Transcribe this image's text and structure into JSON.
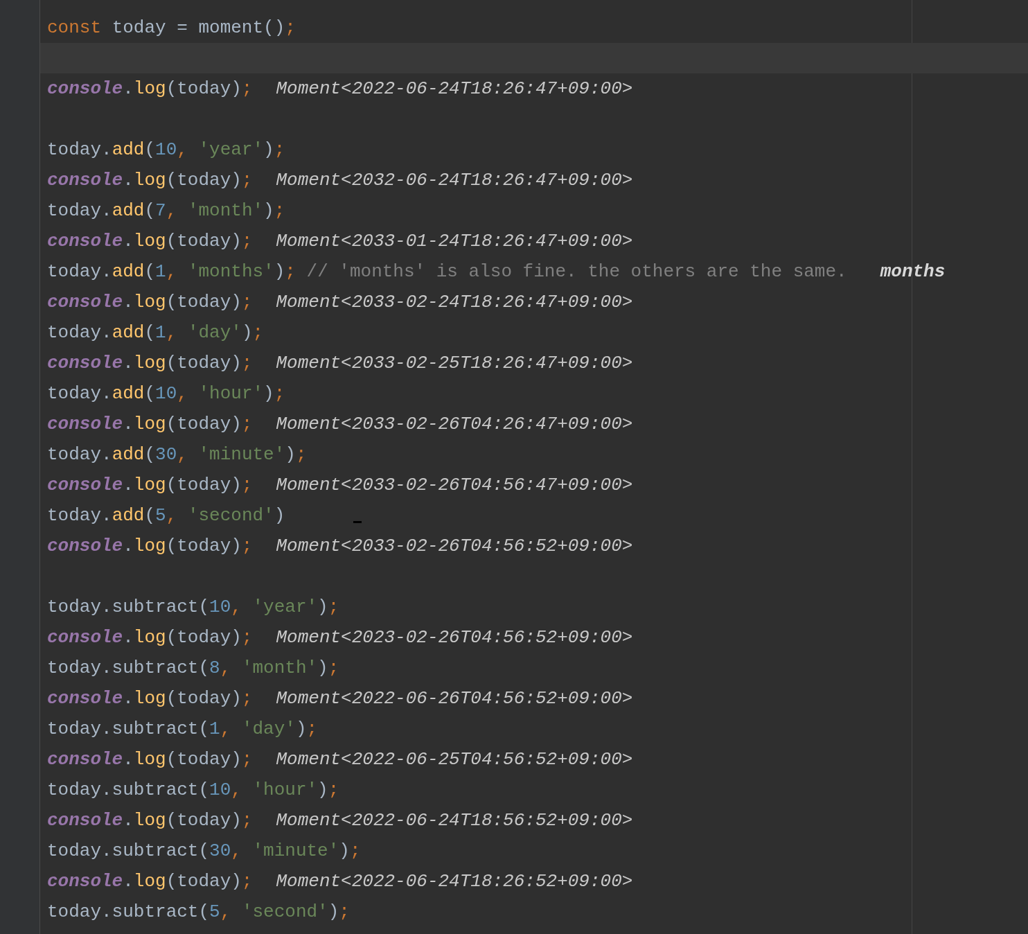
{
  "lines": [
    {
      "kind": "code",
      "tokens": [
        {
          "kind": "keyword",
          "text": "const "
        },
        {
          "kind": "ident",
          "text": "today = moment()"
        },
        {
          "kind": "punct",
          "text": ";"
        }
      ]
    },
    {
      "kind": "current_line"
    },
    {
      "kind": "code",
      "tokens": [
        {
          "kind": "global",
          "text": "console"
        },
        {
          "kind": "ident",
          "text": "."
        },
        {
          "kind": "method",
          "text": "log"
        },
        {
          "kind": "ident",
          "text": "(today)"
        },
        {
          "kind": "punct",
          "text": ";"
        }
      ],
      "hint": "Moment<2022-06-24T18:26:47+09:00>"
    },
    {
      "kind": "blank"
    },
    {
      "kind": "code",
      "tokens": [
        {
          "kind": "ident",
          "text": "today."
        },
        {
          "kind": "method",
          "text": "add"
        },
        {
          "kind": "ident",
          "text": "("
        },
        {
          "kind": "number",
          "text": "10"
        },
        {
          "kind": "punct",
          "text": ", "
        },
        {
          "kind": "string",
          "text": "'year'"
        },
        {
          "kind": "ident",
          "text": ")"
        },
        {
          "kind": "punct",
          "text": ";"
        }
      ]
    },
    {
      "kind": "code",
      "tokens": [
        {
          "kind": "global",
          "text": "console"
        },
        {
          "kind": "ident",
          "text": "."
        },
        {
          "kind": "method",
          "text": "log"
        },
        {
          "kind": "ident",
          "text": "(today)"
        },
        {
          "kind": "punct",
          "text": ";"
        }
      ],
      "hint": "Moment<2032-06-24T18:26:47+09:00>"
    },
    {
      "kind": "code",
      "tokens": [
        {
          "kind": "ident",
          "text": "today."
        },
        {
          "kind": "method",
          "text": "add"
        },
        {
          "kind": "ident",
          "text": "("
        },
        {
          "kind": "number",
          "text": "7"
        },
        {
          "kind": "punct",
          "text": ", "
        },
        {
          "kind": "string",
          "text": "'month'"
        },
        {
          "kind": "ident",
          "text": ")"
        },
        {
          "kind": "punct",
          "text": ";"
        }
      ]
    },
    {
      "kind": "code",
      "tokens": [
        {
          "kind": "global",
          "text": "console"
        },
        {
          "kind": "ident",
          "text": "."
        },
        {
          "kind": "method",
          "text": "log"
        },
        {
          "kind": "ident",
          "text": "(today)"
        },
        {
          "kind": "punct",
          "text": ";"
        }
      ],
      "hint": "Moment<2033-01-24T18:26:47+09:00>"
    },
    {
      "kind": "code",
      "tokens": [
        {
          "kind": "ident",
          "text": "today."
        },
        {
          "kind": "method",
          "text": "add"
        },
        {
          "kind": "ident",
          "text": "("
        },
        {
          "kind": "number",
          "text": "1"
        },
        {
          "kind": "punct",
          "text": ", "
        },
        {
          "kind": "string",
          "text": "'months'"
        },
        {
          "kind": "ident",
          "text": ")"
        },
        {
          "kind": "punct",
          "text": "; "
        },
        {
          "kind": "comment",
          "text": "// 'months' is also fine. the others are the same."
        }
      ],
      "end_hint": "months"
    },
    {
      "kind": "code",
      "tokens": [
        {
          "kind": "global",
          "text": "console"
        },
        {
          "kind": "ident",
          "text": "."
        },
        {
          "kind": "method",
          "text": "log"
        },
        {
          "kind": "ident",
          "text": "(today)"
        },
        {
          "kind": "punct",
          "text": ";"
        }
      ],
      "hint": "Moment<2033-02-24T18:26:47+09:00>"
    },
    {
      "kind": "code",
      "tokens": [
        {
          "kind": "ident",
          "text": "today."
        },
        {
          "kind": "method",
          "text": "add"
        },
        {
          "kind": "ident",
          "text": "("
        },
        {
          "kind": "number",
          "text": "1"
        },
        {
          "kind": "punct",
          "text": ", "
        },
        {
          "kind": "string",
          "text": "'day'"
        },
        {
          "kind": "ident",
          "text": ")"
        },
        {
          "kind": "punct",
          "text": ";"
        }
      ]
    },
    {
      "kind": "code",
      "tokens": [
        {
          "kind": "global",
          "text": "console"
        },
        {
          "kind": "ident",
          "text": "."
        },
        {
          "kind": "method",
          "text": "log"
        },
        {
          "kind": "ident",
          "text": "(today)"
        },
        {
          "kind": "punct",
          "text": ";"
        }
      ],
      "hint": "Moment<2033-02-25T18:26:47+09:00>"
    },
    {
      "kind": "code",
      "tokens": [
        {
          "kind": "ident",
          "text": "today."
        },
        {
          "kind": "method",
          "text": "add"
        },
        {
          "kind": "ident",
          "text": "("
        },
        {
          "kind": "number",
          "text": "10"
        },
        {
          "kind": "punct",
          "text": ", "
        },
        {
          "kind": "string",
          "text": "'hour'"
        },
        {
          "kind": "ident",
          "text": ")"
        },
        {
          "kind": "punct",
          "text": ";"
        }
      ]
    },
    {
      "kind": "code",
      "tokens": [
        {
          "kind": "global",
          "text": "console"
        },
        {
          "kind": "ident",
          "text": "."
        },
        {
          "kind": "method",
          "text": "log"
        },
        {
          "kind": "ident",
          "text": "(today)"
        },
        {
          "kind": "punct",
          "text": ";"
        }
      ],
      "hint": "Moment<2033-02-26T04:26:47+09:00>"
    },
    {
      "kind": "code",
      "tokens": [
        {
          "kind": "ident",
          "text": "today."
        },
        {
          "kind": "method",
          "text": "add"
        },
        {
          "kind": "ident",
          "text": "("
        },
        {
          "kind": "number",
          "text": "30"
        },
        {
          "kind": "punct",
          "text": ", "
        },
        {
          "kind": "string",
          "text": "'minute'"
        },
        {
          "kind": "ident",
          "text": ")"
        },
        {
          "kind": "punct",
          "text": ";"
        }
      ]
    },
    {
      "kind": "code",
      "tokens": [
        {
          "kind": "global",
          "text": "console"
        },
        {
          "kind": "ident",
          "text": "."
        },
        {
          "kind": "method",
          "text": "log"
        },
        {
          "kind": "ident",
          "text": "(today)"
        },
        {
          "kind": "punct",
          "text": ";"
        }
      ],
      "hint": "Moment<2033-02-26T04:56:47+09:00>"
    },
    {
      "kind": "code",
      "tokens": [
        {
          "kind": "ident",
          "text": "today."
        },
        {
          "kind": "method",
          "text": "add"
        },
        {
          "kind": "ident",
          "text": "("
        },
        {
          "kind": "number",
          "text": "5"
        },
        {
          "kind": "punct",
          "text": ", "
        },
        {
          "kind": "string",
          "text": "'second'"
        },
        {
          "kind": "ident",
          "text": ")"
        }
      ],
      "mouse_cursor": true
    },
    {
      "kind": "code",
      "tokens": [
        {
          "kind": "global",
          "text": "console"
        },
        {
          "kind": "ident",
          "text": "."
        },
        {
          "kind": "method",
          "text": "log"
        },
        {
          "kind": "ident",
          "text": "(today)"
        },
        {
          "kind": "punct",
          "text": ";"
        }
      ],
      "hint": "Moment<2033-02-26T04:56:52+09:00>"
    },
    {
      "kind": "blank"
    },
    {
      "kind": "code",
      "tokens": [
        {
          "kind": "ident",
          "text": "today.subtract("
        },
        {
          "kind": "number",
          "text": "10"
        },
        {
          "kind": "punct",
          "text": ", "
        },
        {
          "kind": "string",
          "text": "'year'"
        },
        {
          "kind": "ident",
          "text": ")"
        },
        {
          "kind": "punct",
          "text": ";"
        }
      ]
    },
    {
      "kind": "code",
      "tokens": [
        {
          "kind": "global",
          "text": "console"
        },
        {
          "kind": "ident",
          "text": "."
        },
        {
          "kind": "method",
          "text": "log"
        },
        {
          "kind": "ident",
          "text": "(today)"
        },
        {
          "kind": "punct",
          "text": ";"
        }
      ],
      "hint": "Moment<2023-02-26T04:56:52+09:00>"
    },
    {
      "kind": "code",
      "tokens": [
        {
          "kind": "ident",
          "text": "today.subtract("
        },
        {
          "kind": "number",
          "text": "8"
        },
        {
          "kind": "punct",
          "text": ", "
        },
        {
          "kind": "string",
          "text": "'month'"
        },
        {
          "kind": "ident",
          "text": ")"
        },
        {
          "kind": "punct",
          "text": ";"
        }
      ]
    },
    {
      "kind": "code",
      "tokens": [
        {
          "kind": "global",
          "text": "console"
        },
        {
          "kind": "ident",
          "text": "."
        },
        {
          "kind": "method",
          "text": "log"
        },
        {
          "kind": "ident",
          "text": "(today)"
        },
        {
          "kind": "punct",
          "text": ";"
        }
      ],
      "hint": "Moment<2022-06-26T04:56:52+09:00>"
    },
    {
      "kind": "code",
      "tokens": [
        {
          "kind": "ident",
          "text": "today.subtract("
        },
        {
          "kind": "number",
          "text": "1"
        },
        {
          "kind": "punct",
          "text": ", "
        },
        {
          "kind": "string",
          "text": "'day'"
        },
        {
          "kind": "ident",
          "text": ")"
        },
        {
          "kind": "punct",
          "text": ";"
        }
      ]
    },
    {
      "kind": "code",
      "tokens": [
        {
          "kind": "global",
          "text": "console"
        },
        {
          "kind": "ident",
          "text": "."
        },
        {
          "kind": "method",
          "text": "log"
        },
        {
          "kind": "ident",
          "text": "(today)"
        },
        {
          "kind": "punct",
          "text": ";"
        }
      ],
      "hint": "Moment<2022-06-25T04:56:52+09:00>"
    },
    {
      "kind": "code",
      "tokens": [
        {
          "kind": "ident",
          "text": "today.subtract("
        },
        {
          "kind": "number",
          "text": "10"
        },
        {
          "kind": "punct",
          "text": ", "
        },
        {
          "kind": "string",
          "text": "'hour'"
        },
        {
          "kind": "ident",
          "text": ")"
        },
        {
          "kind": "punct",
          "text": ";"
        }
      ]
    },
    {
      "kind": "code",
      "tokens": [
        {
          "kind": "global",
          "text": "console"
        },
        {
          "kind": "ident",
          "text": "."
        },
        {
          "kind": "method",
          "text": "log"
        },
        {
          "kind": "ident",
          "text": "(today)"
        },
        {
          "kind": "punct",
          "text": ";"
        }
      ],
      "hint": "Moment<2022-06-24T18:56:52+09:00>"
    },
    {
      "kind": "code",
      "tokens": [
        {
          "kind": "ident",
          "text": "today.subtract("
        },
        {
          "kind": "number",
          "text": "30"
        },
        {
          "kind": "punct",
          "text": ", "
        },
        {
          "kind": "string",
          "text": "'minute'"
        },
        {
          "kind": "ident",
          "text": ")"
        },
        {
          "kind": "punct",
          "text": ";"
        }
      ]
    },
    {
      "kind": "code",
      "tokens": [
        {
          "kind": "global",
          "text": "console"
        },
        {
          "kind": "ident",
          "text": "."
        },
        {
          "kind": "method",
          "text": "log"
        },
        {
          "kind": "ident",
          "text": "(today)"
        },
        {
          "kind": "punct",
          "text": ";"
        }
      ],
      "hint": "Moment<2022-06-24T18:26:52+09:00>"
    },
    {
      "kind": "code",
      "tokens": [
        {
          "kind": "ident",
          "text": "today.subtract("
        },
        {
          "kind": "number",
          "text": "5"
        },
        {
          "kind": "punct",
          "text": ", "
        },
        {
          "kind": "string",
          "text": "'second'"
        },
        {
          "kind": "ident",
          "text": ")"
        },
        {
          "kind": "punct",
          "text": ";"
        }
      ]
    }
  ]
}
